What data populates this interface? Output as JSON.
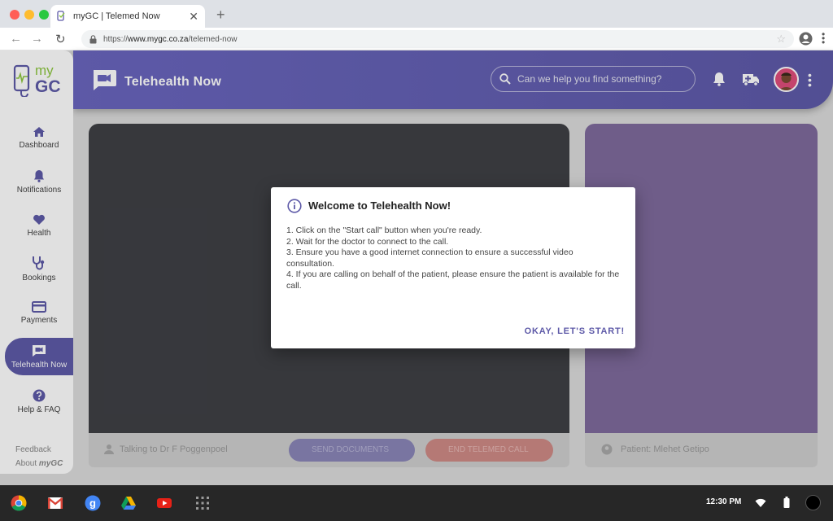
{
  "browser": {
    "tab_title": "myGC | Telemed Now",
    "url_prefix": "https://",
    "url_domain": "www.mygc.co.za",
    "url_path": "/telemed-now"
  },
  "logo": {
    "line1": "my",
    "line2": "GC"
  },
  "header": {
    "title": "Telehealth Now",
    "search_placeholder": "Can we help you find something?"
  },
  "sidebar": {
    "items": [
      {
        "label": "Dashboard",
        "icon": "home-icon"
      },
      {
        "label": "Notifications",
        "icon": "bell-icon"
      },
      {
        "label": "Health",
        "icon": "heart-icon"
      },
      {
        "label": "Bookings",
        "icon": "stethoscope-icon"
      },
      {
        "label": "Payments",
        "icon": "card-icon"
      },
      {
        "label": "Telehealth Now",
        "icon": "video-icon",
        "active": true
      },
      {
        "label": "Help & FAQ",
        "icon": "help-icon"
      }
    ],
    "feedback": "Feedback",
    "about_prefix": "About ",
    "about_brand": "myGC"
  },
  "call": {
    "talking_to": "Talking to Dr F Poggenpoel",
    "send_documents": "SEND DOCUMENTS",
    "end_call": "END TELEMED CALL",
    "patient": "Patient: Mlehet Getipo"
  },
  "dialog": {
    "title": "Welcome to Telehealth Now!",
    "steps": [
      "1. Click on the \"Start call\" button when you're ready.",
      "2. Wait for the doctor to connect to the call.",
      "3. Ensure you have a good internet connection to ensure a successful video consultation.",
      "4. If you are calling on behalf of the patient, please ensure the patient is available for the call."
    ],
    "confirm": "OKAY, LET'S START!"
  },
  "shelf": {
    "time": "12:30 PM"
  },
  "colors": {
    "primary": "#5e5aa8",
    "accent": "#8dc63f",
    "panel": "#7f6a9c"
  }
}
